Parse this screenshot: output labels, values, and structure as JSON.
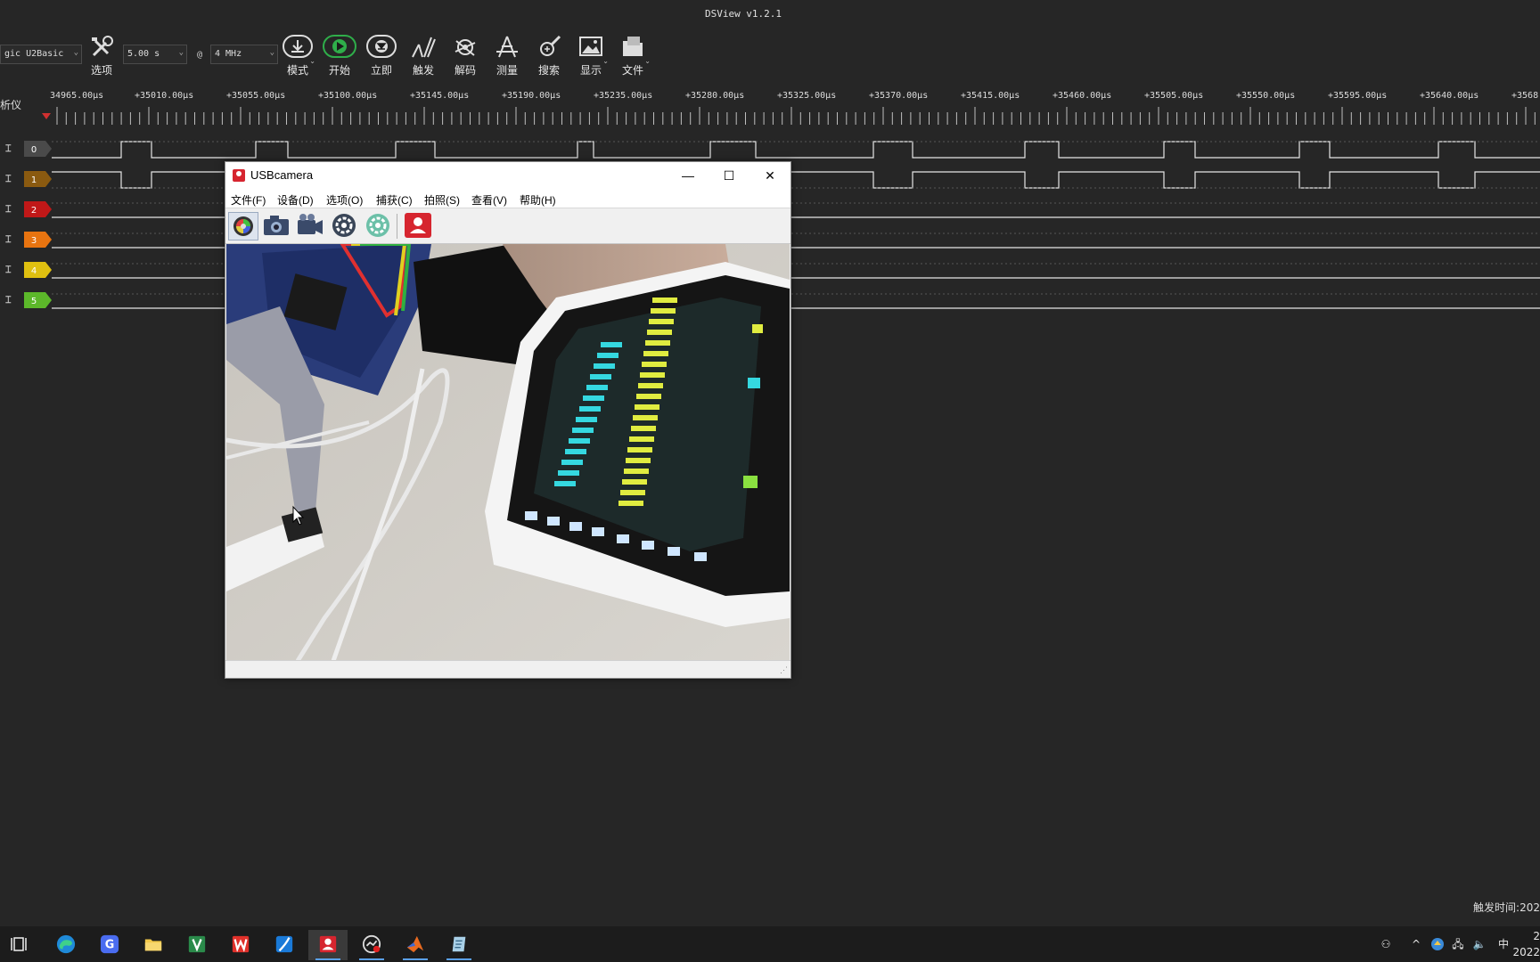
{
  "app": {
    "title": "DSView v1.2.1"
  },
  "toolbar": {
    "device": "gic U2Basic",
    "duration": "5.00 s",
    "at": "@",
    "rate": "4 MHz",
    "buttons": {
      "options": "选项",
      "mode": "模式",
      "start": "开始",
      "instant": "立即",
      "trigger": "触发",
      "decode": "解码",
      "measure": "测量",
      "search": "搜索",
      "display": "显示",
      "file": "文件"
    }
  },
  "ruler": {
    "left_label": "析仪",
    "labels": [
      "34965.00μs",
      "+35010.00μs",
      "+35055.00μs",
      "+35100.00μs",
      "+35145.00μs",
      "+35190.00μs",
      "+35235.00μs",
      "+35280.00μs",
      "+35325.00μs",
      "+35370.00μs",
      "+35415.00μs",
      "+35460.00μs",
      "+35505.00μs",
      "+35550.00μs",
      "+35595.00μs",
      "+35640.00μs",
      "+3568"
    ]
  },
  "channels": [
    {
      "id": "0",
      "color": "#4a4a4a"
    },
    {
      "id": "1",
      "color": "#8a5a10"
    },
    {
      "id": "2",
      "color": "#c01818"
    },
    {
      "id": "3",
      "color": "#e87410"
    },
    {
      "id": "4",
      "color": "#e0c010"
    },
    {
      "id": "5",
      "color": "#5cb82a"
    }
  ],
  "usbcamera": {
    "title": "USBcamera",
    "menu": {
      "file": "文件(F)",
      "device": "设备(D)",
      "options": "选项(O)",
      "capture": "捕获(C)",
      "photo": "拍照(S)",
      "view": "查看(V)",
      "help": "帮助(H)"
    },
    "window_controls": {
      "minimize": "—",
      "maximize": "☐",
      "close": "✕"
    }
  },
  "status": {
    "trigger_time": "触发时间:202"
  },
  "taskbar": {
    "items": [
      "task-view",
      "edge",
      "browser-g",
      "file-explorer",
      "spreadsheet",
      "wps",
      "editor",
      "usbcamera",
      "dsview",
      "matlab",
      "notepad"
    ],
    "tray": {
      "ime": "中"
    },
    "clock": {
      "time": "2",
      "date": "2022"
    }
  }
}
